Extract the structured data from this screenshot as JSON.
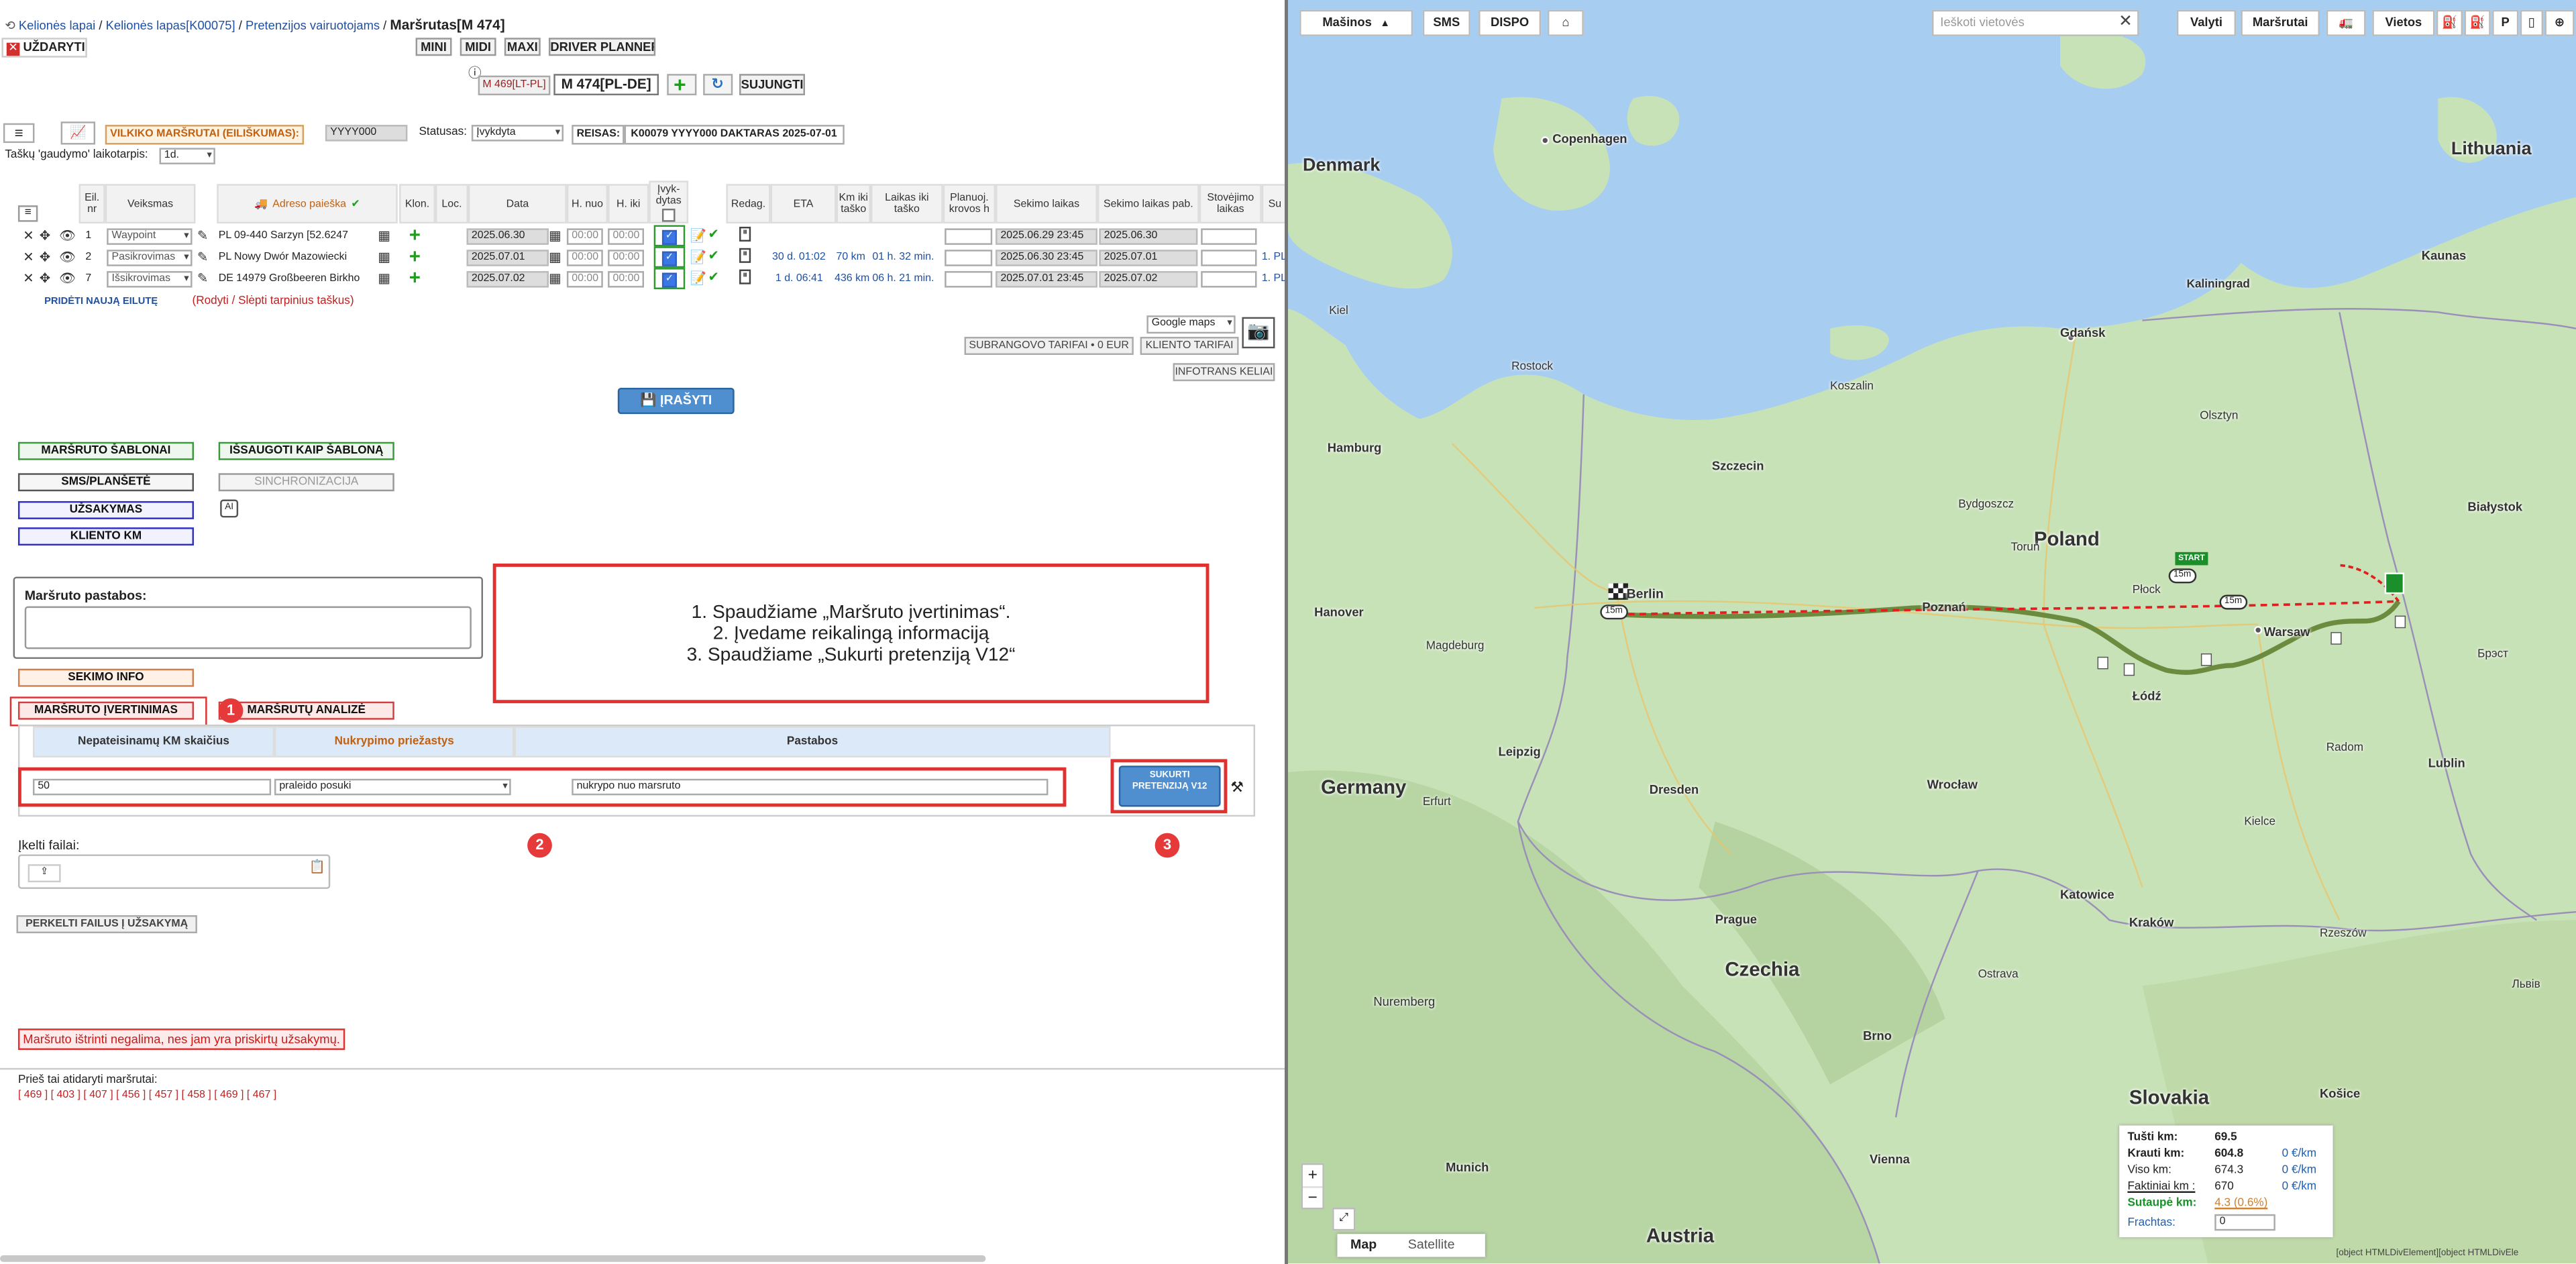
{
  "breadcrumb": {
    "home_icon": "refresh-icon",
    "items": [
      "Kelionės lapai",
      "Kelionės lapas[K00075]",
      "Pretenzijos vairuotojams"
    ],
    "current": "Maršrutas[M 474]"
  },
  "close_button": "UŽDARYTI",
  "view_buttons": [
    "MINI",
    "MIDI",
    "MAXI",
    "DRIVER PLANNER"
  ],
  "route_nav": {
    "prev": "M 469[LT-PL]",
    "current": "M 474[PL-DE]",
    "join": "SUJUNGTI"
  },
  "filter_bar": {
    "label": "VILKIKO MARŠRUTAI (EILIŠKUMAS):",
    "truck": "YYYY000",
    "status_label": "Statusas:",
    "status_value": "Įvykdyta",
    "trip_label": "REISAS:",
    "trip_value": "K00079 YYYY000 DAKTARAS 2025-07-01"
  },
  "catch_label": "Taškų 'gaudymo' laikotarpis:",
  "catch_value": "1d.",
  "route_table": {
    "headers": {
      "nr": "Eil. nr",
      "action": "Veiksmas",
      "address": "Adreso paieška",
      "klon": "Klon.",
      "loc": "Loc.",
      "date": "Data",
      "hfrom": "H. nuo",
      "hto": "H. iki",
      "done": "Įvyk-dytas",
      "edit": "Redag.",
      "eta": "ETA",
      "km": "Km iki taško",
      "time": "Laikas iki taško",
      "planned": "Planuoj. krovos h",
      "track": "Sekimo laikas",
      "trackend": "Sekimo laikas pab.",
      "stand": "Stovėjimo laikas",
      "su": "Su"
    },
    "rows": [
      {
        "nr": "1",
        "action": "Waypoint",
        "country": "PL",
        "address": "09-440 Sarzyn  [52.6247",
        "date": "2025.06.30",
        "hfrom": "00:00",
        "hto": "00:00",
        "eta": "",
        "km": "",
        "time": "",
        "track": "2025.06.29 23:45",
        "trackend": "2025.06.30",
        "extra": ""
      },
      {
        "nr": "2",
        "action": "Pasikrovimas",
        "country": "PL",
        "address": "Nowy Dwór Mazowiecki",
        "date": "2025.07.01",
        "hfrom": "00:00",
        "hto": "00:00",
        "eta": "30 d. 01:02",
        "km": "70 km",
        "time": "01 h. 32 min.",
        "track": "2025.06.30 23:45",
        "trackend": "2025.07.01",
        "extra": "1. PL"
      },
      {
        "nr": "7",
        "action": "Išsikrovimas",
        "country": "DE",
        "address": "14979 Großbeeren Birkho",
        "date": "2025.07.02",
        "hfrom": "00:00",
        "hto": "00:00",
        "eta": "1 d. 06:41",
        "km": "436 km",
        "time": "06 h. 21 min.",
        "track": "2025.07.01 23:45",
        "trackend": "2025.07.02",
        "extra": "1. PL"
      }
    ],
    "add_row": "PRIDĖTI NAUJĄ EILUTĘ",
    "toggle_points": "(Rodyti / Slėpti tarpinius taškus)"
  },
  "maps_select": "Google maps",
  "tariff_buttons": [
    "SUBRANGOVO TARIFAI • 0 EUR",
    "KLIENTO TARIFAI"
  ],
  "infotrans_button": "INFOTRANS KELIAI",
  "save_button": "ĮRAŠYTI",
  "left_buttons": {
    "templates": "MARŠRUTO ŠABLONAI",
    "save_template": "IŠSAUGOTI KAIP ŠABLONĄ",
    "sms": "SMS/PLANŠETĖ",
    "sync": "SINCHRONIZACIJA",
    "order": "UŽSAKYMAS",
    "client_km": "KLIENTO KM"
  },
  "notes_label": "Maršruto pastabos:",
  "instructions": [
    "1. Spaudžiame „Maršruto įvertinimas“.",
    "2. Įvedame reikalingą informaciją",
    "3. Spaudžiame „Sukurti pretenziją V12“"
  ],
  "tracking_info": "SEKIMO INFO",
  "route_eval": "MARŠRUTO ĮVERTINIMAS",
  "route_analysis": "MARŠRUTŲ ANALIZĖ",
  "eval_table": {
    "col1": "Nepateisinamų KM skaičius",
    "col2": "Nukrypimo priežastys",
    "col3": "Pastabos",
    "km": "50",
    "reason": "praleido posuki",
    "note": "nukrypo nuo marsruto",
    "create": "SUKURTI PRETENZIJĄ V12"
  },
  "markers": [
    "1",
    "2",
    "3"
  ],
  "files_label": "Įkelti failai:",
  "move_files": "PERKELTI FAILUS Į UŽSAKYMĄ",
  "warning": "Maršruto ištrinti negalima, nes jam yra priskirtų užsakymų.",
  "prev_routes_label": "Prieš tai atidaryti maršrutai:",
  "prev_routes": [
    "[ 469 ]",
    "[ 403 ]",
    "[ 407 ]",
    "[ 456 ]",
    "[ 457 ]",
    "[ 458 ]",
    "[ 469 ]",
    "[ 467 ]"
  ],
  "map": {
    "toolbar": {
      "machines": "Mašinos",
      "sms": "SMS",
      "dispo": "DISPO",
      "search_placeholder": "Ieškoti vietovės",
      "valyti": "Valyti",
      "routes": "Maršrutai",
      "places": "Vietos"
    },
    "labels": {
      "denmark": "Denmark",
      "lithuania": "Lithuania",
      "poland": "Poland",
      "germany": "Germany",
      "czechia": "Czechia",
      "slovakia": "Slovakia",
      "austria": "Austria",
      "copenhagen": "Copenhagen",
      "berlin": "Berlin",
      "warsaw": "Warsaw",
      "poznan": "Poznań",
      "gdansk": "Gdańsk",
      "hamburg": "Hamburg",
      "szczecin": "Szczecin",
      "wroclaw": "Wrocław",
      "krakow": "Kraków",
      "prague": "Prague",
      "lodz": "Łódź",
      "vienna": "Vienna",
      "kaunas": "Kaunas",
      "kaliningrad": "Kaliningrad",
      "bialystok": "Białystok",
      "lublin": "Lublin",
      "katowice": "Katowice",
      "dresden": "Dresden",
      "leipzig": "Leipzig",
      "hanover": "Hanover",
      "rostock": "Rostock",
      "kiel": "Kiel",
      "magdeburg": "Magdeburg",
      "munich": "Munich",
      "brno": "Brno",
      "kosice": "Košice",
      "lviv": "Львів",
      "nuremberg": "Nuremberg",
      "bydgoszcz": "Bydgoszcz",
      "olsztyn": "Olsztyn",
      "plock": "Płock",
      "kielce": "Kielce",
      "brest": "Брэст",
      "koszalin": "Koszalin",
      "ostrava": "Ostrava",
      "erfurt": "Erfurt",
      "torun": "Toruń",
      "radom": "Radom",
      "rzeszow": "Rzeszów"
    },
    "start_marker": "START",
    "time_badge": "15m",
    "zoom_in": "+",
    "zoom_out": "−",
    "map_tab": "Map",
    "satellite_tab": "Satellite",
    "stats": {
      "empty_label": "Tušti km:",
      "empty": "69.5",
      "loaded_label": "Krauti km:",
      "loaded": "604.8",
      "loaded_eur": "0 €/km",
      "total_label": "Viso km:",
      "total": "674.3",
      "total_eur": "0 €/km",
      "fact_label": "Faktiniai km :",
      "fact": "670",
      "fact_eur": "0 €/km",
      "saved_label": "Sutaupė km:",
      "saved": "4.3 (0.6%)",
      "freight_label": "Frachtas:",
      "freight": "0"
    },
    "footer": "[object HTMLDivElement][object HTMLDivEle"
  },
  "colors": {
    "accent_blue": "#3a78c8",
    "alert_red": "#e03030",
    "green": "#2d9a2d",
    "route_planned": "#e02020",
    "route_actual": "#6d8b3e"
  }
}
